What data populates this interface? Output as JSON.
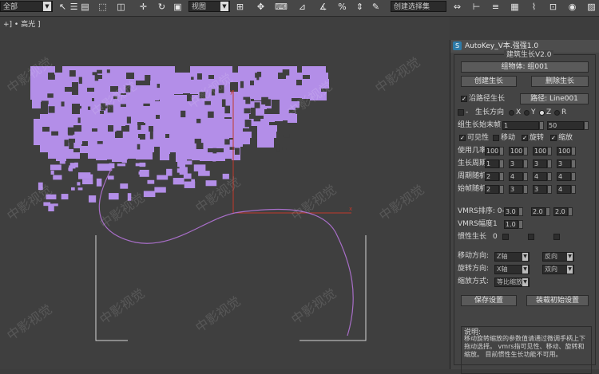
{
  "toolbar": {
    "dropdown_all": "全部",
    "dropdown_view": "视图",
    "dropdown_selection": "创建选择集"
  },
  "viewport": {
    "label": "+] • 高光 ]",
    "watermark": "中影视觉",
    "piece_color": "#b38ee8",
    "axis_color": "#c0392b",
    "spline_color": "#a86ec8"
  },
  "panel": {
    "title": "AutoKey_V本.强强1.0",
    "heading": "建筑生长V2.0",
    "group_label": "组物体:",
    "group_value": "组001",
    "create_button": "创建生长",
    "delete_button": "删除生长",
    "path_check_label": "沿路径生长",
    "path_button": "路径: Line001",
    "growth_dir_label": "生长方向",
    "axis_x": "X",
    "axis_y": "Y",
    "axis_z": "Z",
    "axis_r": "R",
    "start_end_label": "组生长始末帧",
    "start_value": "1",
    "end_value": "50",
    "visibility_label": "可见性",
    "move_label": "移动",
    "rotate_label": "旋转",
    "scale_label": "缩放",
    "probability_label": "使用几率",
    "probability_values": [
      "100",
      "100",
      "100",
      "100"
    ],
    "growth_period_label": "生长周期",
    "growth_period_values": [
      "1",
      "3",
      "3",
      "3"
    ],
    "period_random_label": "周期随机",
    "period_random_values": [
      "2",
      "4",
      "4",
      "4"
    ],
    "start_random_label": "始帧随机",
    "start_random_values": [
      "2",
      "3",
      "3",
      "4"
    ],
    "vmrs_order_label": "VMRS排序: 0-1",
    "vmrs_order_values": [
      "3.0",
      "2.0",
      "2.0"
    ],
    "vmrs_amp_label": "VMRS幅度",
    "vmrs_amp_value": "1",
    "vmrs_amp_field": "1.0",
    "inertia_label": "惯性生长",
    "inertia_value": "0",
    "move_dir_label": "移动方向:",
    "move_dir_a": "Z轴",
    "move_dir_b": "反向",
    "rot_dir_label": "旋转方向:",
    "rot_dir_a": "X轴",
    "rot_dir_b": "双向",
    "scale_mode_label": "缩放方式:",
    "scale_mode_value": "等比缩放",
    "save_button": "保存设置",
    "load_button": "装载初始设置",
    "desc_title": "说明:",
    "desc_text": "移动旋转缩放的参数值请通过微调手柄上下拖动选择。 vmrs指可见性、移动、旋转和缩放。 目前惯性生长功能不可用。"
  }
}
